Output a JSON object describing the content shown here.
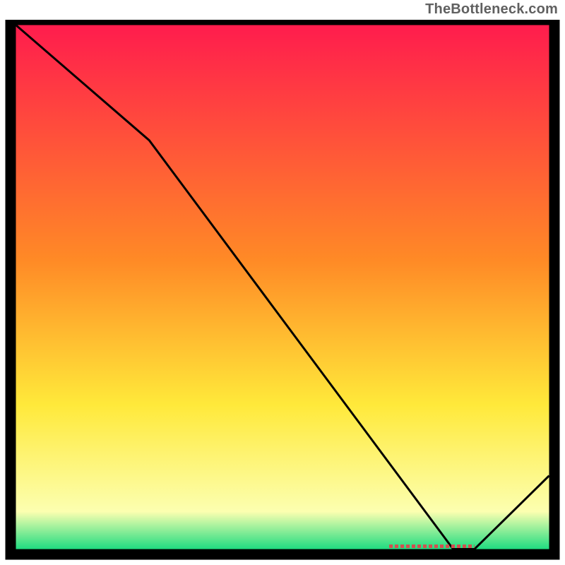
{
  "attribution": "TheBottleneck.com",
  "colors": {
    "gradient_top": "#ff1a4e",
    "gradient_mid1": "#ff8a26",
    "gradient_mid2": "#ffe93a",
    "gradient_near_bottom": "#fcffb0",
    "gradient_bottom": "#00d77a",
    "frame": "#000000",
    "line": "#000000",
    "marker": "#d05050"
  },
  "chart_data": {
    "type": "line",
    "title": "",
    "xlabel": "",
    "ylabel": "",
    "xlim": [
      0,
      100
    ],
    "ylim": [
      0,
      100
    ],
    "x": [
      0,
      25,
      82,
      86,
      100
    ],
    "values": [
      100,
      78,
      0,
      0,
      14
    ],
    "marker_segment": {
      "x_start": 70,
      "x_end": 86,
      "y": 0
    },
    "notes": "Values are estimated from pixel positions on an unlabeled 0–100 × 0–100 normalized domain; the chart has no visible axis ticks or numeric labels."
  }
}
